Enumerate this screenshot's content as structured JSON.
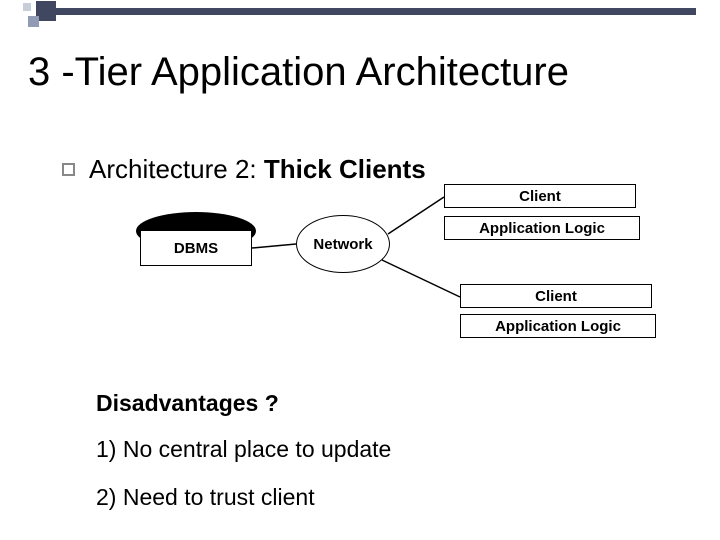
{
  "title": "3 -Tier Application Architecture",
  "bullet": {
    "prefix": "Architecture 2: ",
    "bold": "Thick Clients"
  },
  "diagram": {
    "dbms": "DBMS",
    "network": "Network",
    "client1": "Client",
    "applogic1": "Application Logic",
    "client2": "Client",
    "applogic2": "Application Logic"
  },
  "disadvantages": {
    "heading": "Disadvantages ?",
    "point1": "1) No central place to update",
    "point2": "2) Need to trust client"
  }
}
